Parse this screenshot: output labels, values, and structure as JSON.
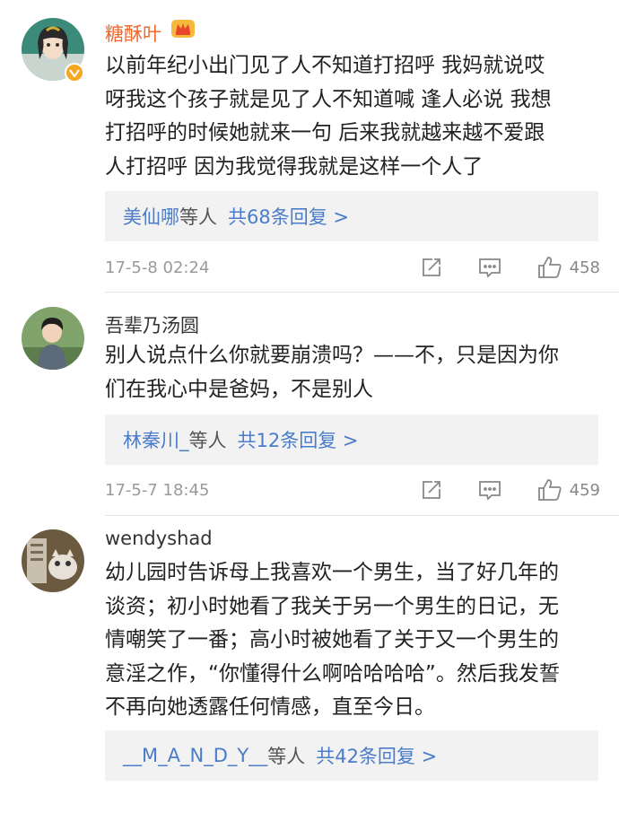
{
  "comments": [
    {
      "username": "糖酥叶",
      "lines": [
        "以前年纪小出门见了人不知道打招呼 我妈就说哎",
        "呀我这个孩子就是见了人不知道喊 逢人必说 我想",
        "打招呼的时候她就来一句 后来我就越来越不爱跟",
        "人打招呼 因为我觉得我就是这样一个人了"
      ],
      "reply_users": "美仙哪",
      "reply_suffix": "等人",
      "reply_count": "共68条回复 >",
      "time": "17-5-8 02:24",
      "likes": "458"
    },
    {
      "username": "吾辈乃汤圆",
      "lines": [
        "别人说点什么你就要崩溃吗？——不，只是因为你",
        "们在我心中是爸妈，不是别人"
      ],
      "reply_users": "林秦川_",
      "reply_suffix": "等人",
      "reply_count": "共12条回复 >",
      "time": "17-5-7 18:45",
      "likes": "459"
    },
    {
      "username": "wendyshad",
      "lines": [
        "幼儿园时告诉母上我喜欢一个男生，当了好几年的",
        "谈资；初小时她看了我关于另一个男生的日记，无",
        "情嘲笑了一番；高小时被她看了关于又一个男生的",
        "意淫之作，“你懂得什么啊哈哈哈哈”。然后我发誓",
        "不再向她透露任何情感，直至今日。"
      ],
      "reply_users": "__M_A_N_D_Y__",
      "reply_suffix": "等人",
      "reply_count": "共42条回复 >",
      "time": "",
      "likes": ""
    }
  ],
  "colors": {
    "vip_name": "#f2672a",
    "link": "#4a7cc9",
    "reply_bg": "#f2f2f2",
    "meta": "#999999",
    "badge": "#f5a623"
  },
  "icons": [
    "crown-icon",
    "verified-badge-icon",
    "repost-icon",
    "comment-icon",
    "like-icon"
  ]
}
